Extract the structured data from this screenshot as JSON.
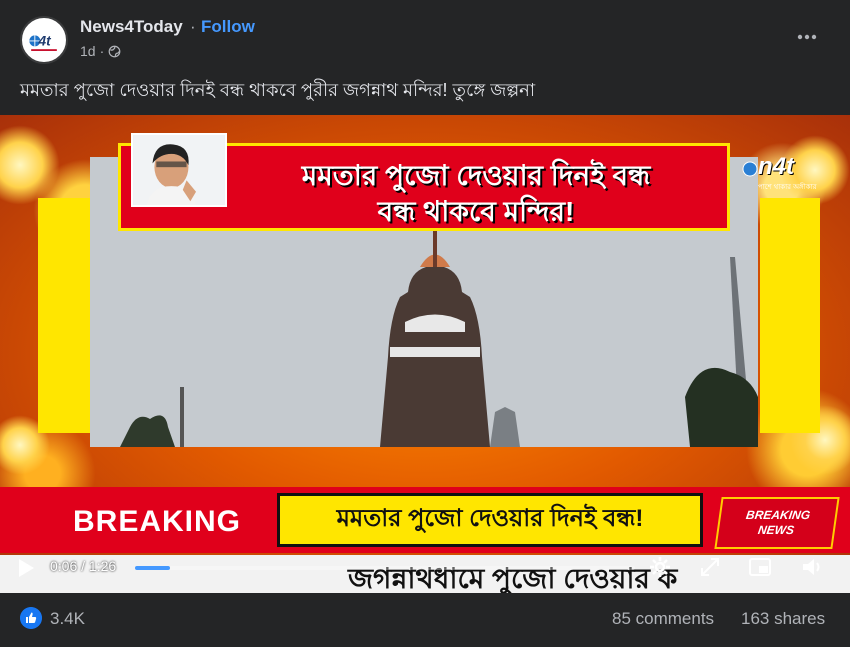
{
  "post": {
    "page_name": "News4Today",
    "separator": "·",
    "follow_label": "Follow",
    "time_ago": "1d",
    "audience_icon": "globe-icon",
    "more_icon": "more-options-icon",
    "caption": "মমতার পুজো দেওয়ার দিনই বন্ধ থাকবে পুরীর জগন্নাথ মন্দির! তুঙ্গে জল্পনা"
  },
  "avatar": {
    "logo_text": "n4t"
  },
  "video": {
    "top_banner_line1": "মমতার পুজো দেওয়ার দিনই বন্ধ",
    "top_banner_line2": "বন্ধ থাকবে মন্দির!",
    "channel_logo": "n4t",
    "channel_tagline": "পাশে থাকার অঙ্গীকার",
    "breaking_label": "BREAKING",
    "breaking_headline": "মমতার পুজো দেওয়ার দিনই বন্ধ!",
    "breaking_badge_line1": "BREAKING",
    "breaking_badge_line2": "NEWS",
    "ticker": "জগন্নাথধামে পুজো দেওয়ার ক",
    "colors": {
      "banner_red": "#e0001b",
      "banner_yellow": "#ffe600",
      "fire_orange": "#ff8a00"
    }
  },
  "player": {
    "play_icon": "play-icon",
    "current_time": "0:06",
    "duration": "1:26",
    "time_display": "0:06 / 1:26",
    "progress_fraction": 0.07,
    "icons": [
      "settings-icon",
      "fullscreen-expand-icon",
      "picture-in-picture-icon",
      "volume-icon"
    ],
    "accent": "#4599ff"
  },
  "footer": {
    "reaction_icon": "like-icon",
    "reaction_count": "3.4K",
    "comments": "85 comments",
    "shares": "163 shares"
  }
}
